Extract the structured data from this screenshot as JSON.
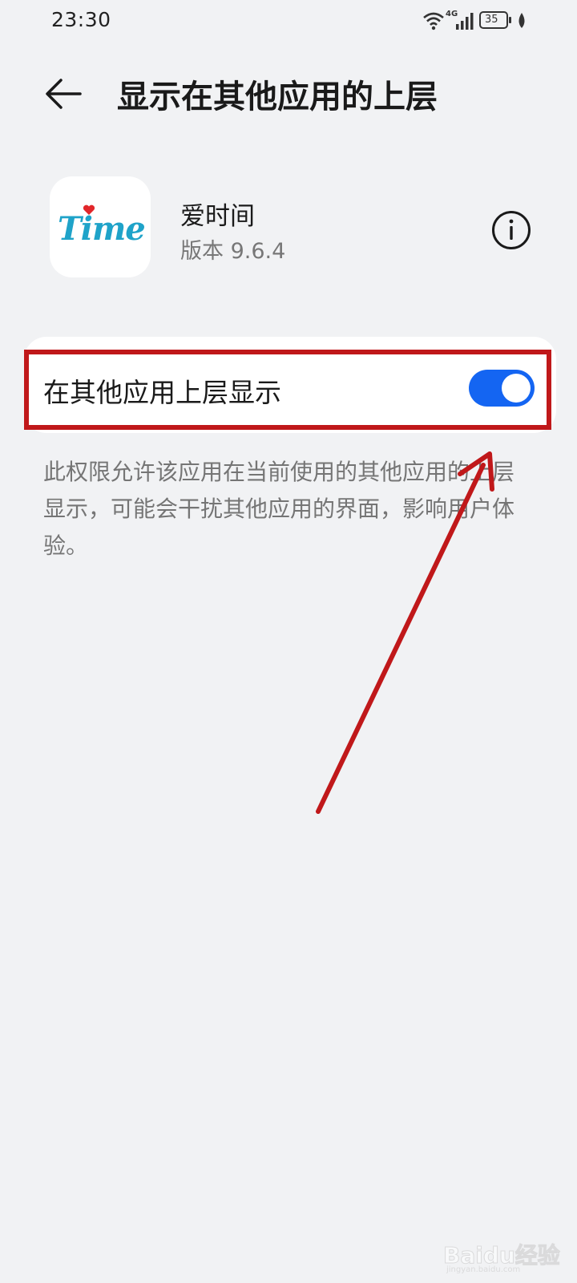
{
  "status_bar": {
    "time": "23:30",
    "network": "4G",
    "battery": "35",
    "icons": [
      "wifi-icon",
      "signal-icon",
      "battery-icon",
      "leaf-icon"
    ]
  },
  "header": {
    "back_icon": "back-arrow-icon",
    "title": "显示在其他应用的上层"
  },
  "app": {
    "icon_text": "Time",
    "name": "爱时间",
    "version": "版本 9.6.4",
    "info_icon": "info-icon"
  },
  "setting": {
    "label": "在其他应用上层显示",
    "enabled": true,
    "description": "此权限允许该应用在当前使用的其他应用的上层显示，可能会干扰其他应用的界面，影响用户体验。"
  },
  "annotation": {
    "color": "#c0181a"
  },
  "watermark": {
    "text": "Baidu经验",
    "sub": "jingyan.baidu.com"
  },
  "colors": {
    "background": "#f1f2f4",
    "toggle_on": "#1465f2",
    "app_icon_text": "#1fa3c9"
  }
}
